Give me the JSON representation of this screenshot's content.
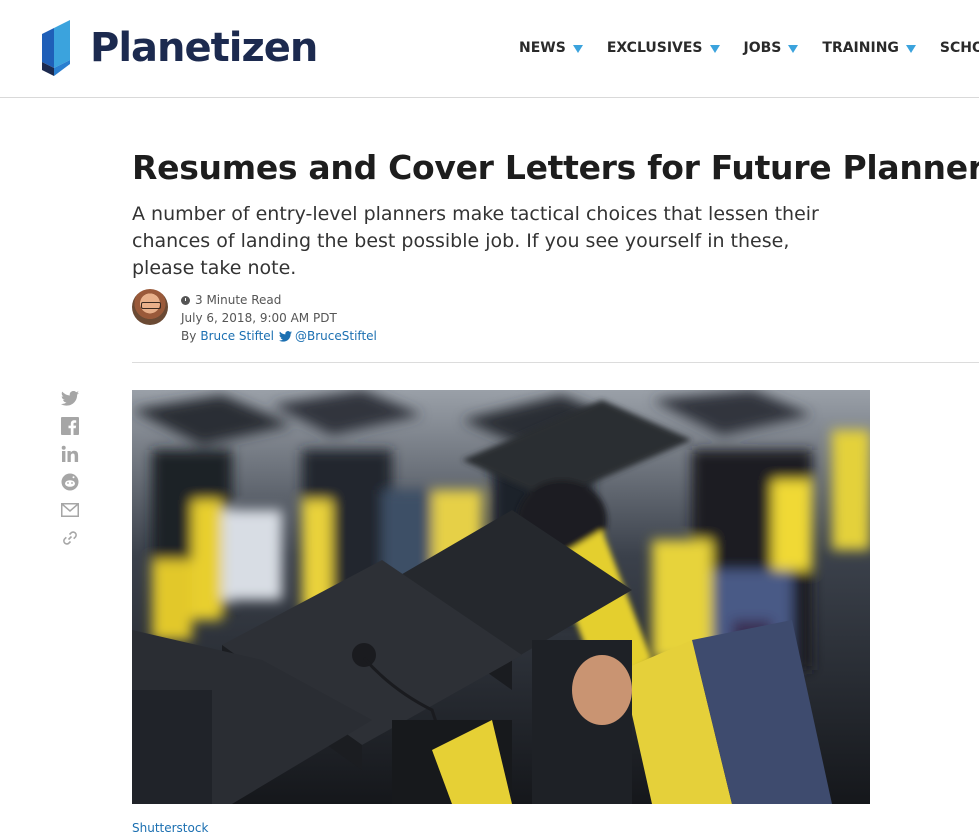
{
  "site": {
    "name": "Planetizen",
    "brand_color": "#1c2a4f",
    "accent_color": "#3ba3dd"
  },
  "nav": [
    {
      "label": "NEWS",
      "dropdown": true
    },
    {
      "label": "EXCLUSIVES",
      "dropdown": true
    },
    {
      "label": "JOBS",
      "dropdown": true
    },
    {
      "label": "TRAINING",
      "dropdown": true
    },
    {
      "label": "SCHOOLS",
      "dropdown": false
    }
  ],
  "article": {
    "title": "Resumes and Cover Letters for Future Planners",
    "subtitle": "A number of entry-level planners make tactical choices that lessen their chances of landing the best possible job. If you see yourself in these, please take note.",
    "read_time": "3 Minute Read",
    "date": "July 6, 2018, 9:00 AM PDT",
    "by_prefix": "By",
    "author": "Bruce Stiftel",
    "twitter_handle": "@BruceStiftel",
    "image_caption": "Shutterstock",
    "link_color": "#1b6fb1"
  },
  "share_icons": [
    "twitter-icon",
    "facebook-icon",
    "linkedin-icon",
    "reddit-icon",
    "email-icon",
    "link-icon"
  ]
}
